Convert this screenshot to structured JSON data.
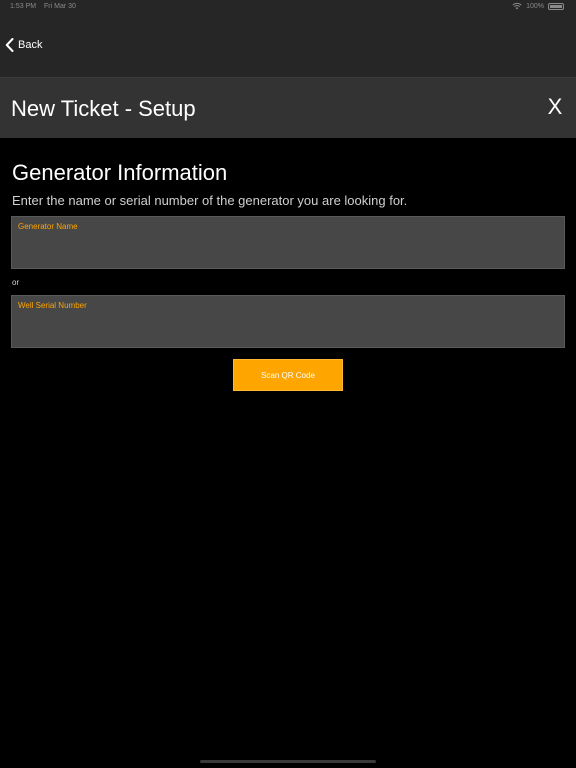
{
  "status_bar": {
    "time": "1:53 PM",
    "date": "Fri Mar 30",
    "battery": "100%",
    "wifi_icon": "wifi-icon",
    "battery_icon": "battery-icon"
  },
  "nav": {
    "back_label": "Back",
    "back_icon": "chevron-left-icon"
  },
  "header": {
    "title": "New Ticket - Setup",
    "close_label": "X"
  },
  "content": {
    "section_title": "Generator Information",
    "subtitle": "Enter the name or serial number of the generator you are looking for.",
    "generator_field": {
      "label": "Generator Name",
      "value": "",
      "placeholder": ""
    },
    "or_text": "or",
    "serial_field": {
      "label": "Well Serial Number",
      "value": "",
      "placeholder": ""
    },
    "scan_button_label": "Scan QR Code"
  },
  "colors": {
    "background": "#000000",
    "bar": "#262626",
    "header": "#333333",
    "field": "#474747",
    "accent": "#ffa500"
  }
}
